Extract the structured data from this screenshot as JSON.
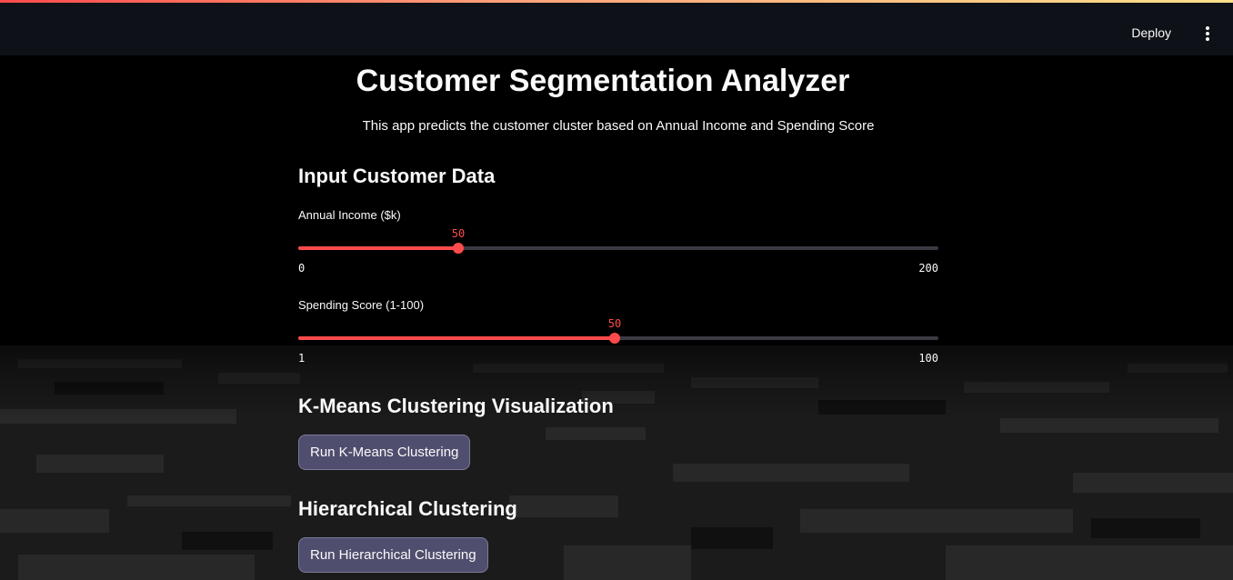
{
  "header": {
    "deploy_label": "Deploy",
    "menu_icon": "vertical-ellipsis-icon"
  },
  "title": "Customer Segmentation Analyzer",
  "subtitle": "This app predicts the customer cluster based on Annual Income and Spending Score",
  "input_section": {
    "heading": "Input Customer Data",
    "income_slider": {
      "label": "Annual Income ($k)",
      "value": 50,
      "min": 0,
      "max": 200,
      "value_text": "50",
      "min_text": "0",
      "max_text": "200"
    },
    "spending_slider": {
      "label": "Spending Score (1-100)",
      "value": 50,
      "min": 1,
      "max": 100,
      "value_text": "50",
      "min_text": "1",
      "max_text": "100"
    }
  },
  "kmeans_section": {
    "heading": "K-Means Clustering Visualization",
    "button_label": "Run K-Means Clustering"
  },
  "hierarchical_section": {
    "heading": "Hierarchical Clustering",
    "button_label": "Run Hierarchical Clustering"
  },
  "colors": {
    "accent": "#ff4b4b",
    "header_bg": "#0e1117",
    "button_bg": "#4f4e6e"
  }
}
